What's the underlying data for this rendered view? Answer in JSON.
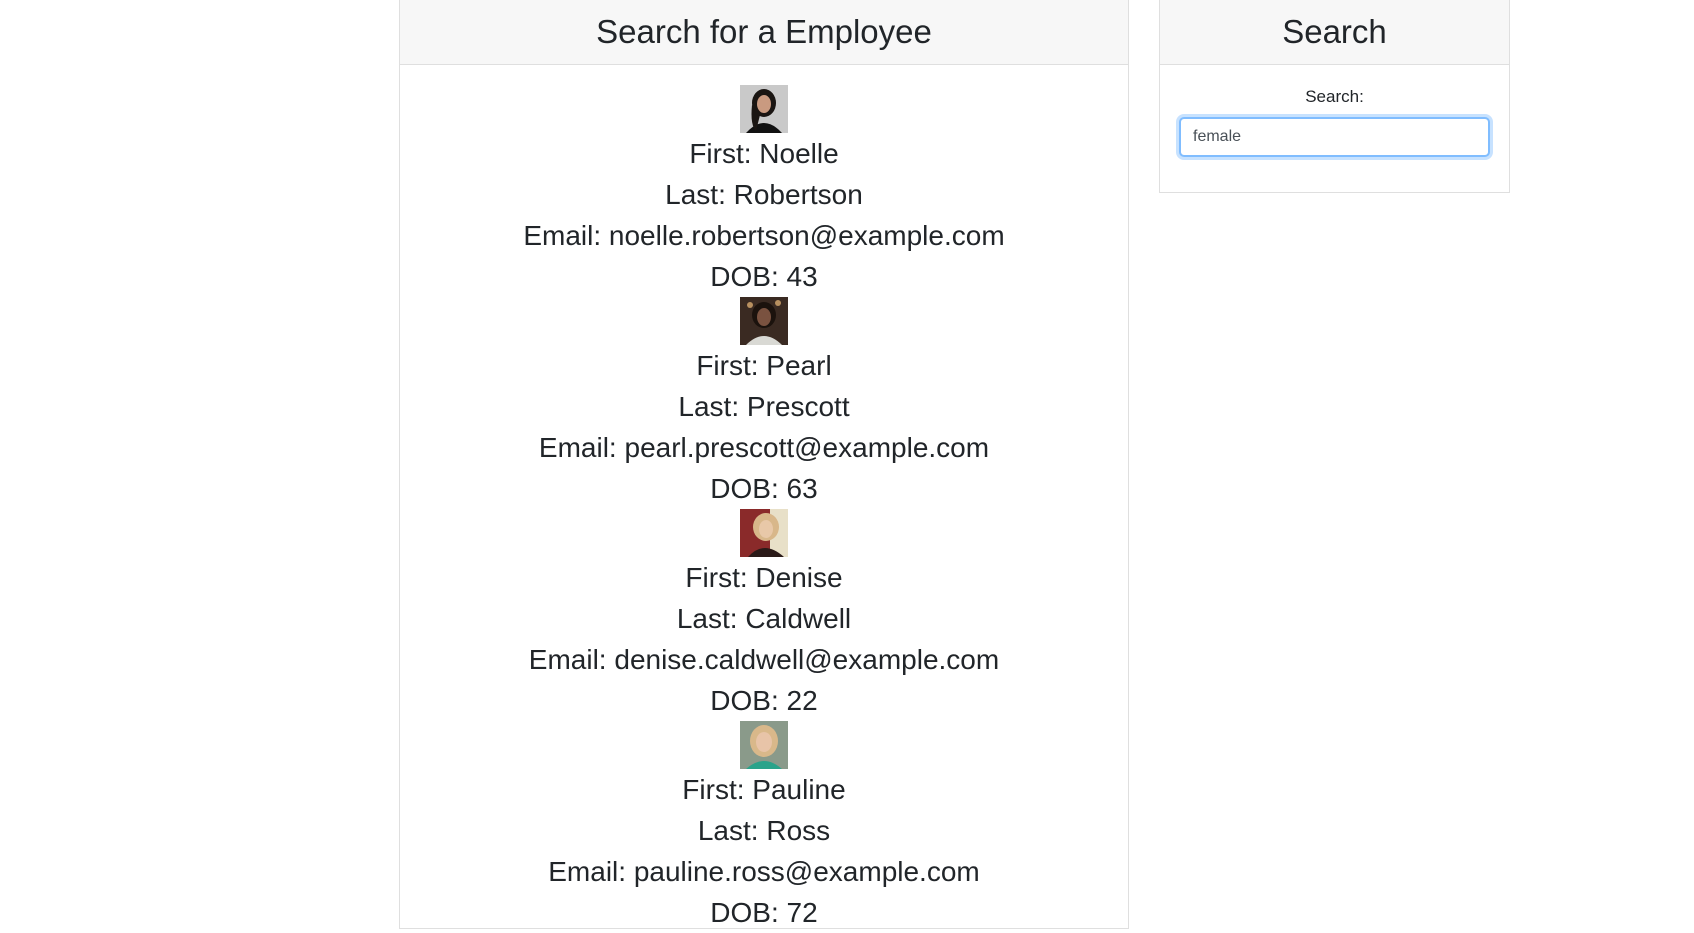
{
  "main": {
    "title": "Search for a Employee",
    "employees": [
      {
        "first": "First: Noelle",
        "last": "Last: Robertson",
        "email": "Email: noelle.robertson@example.com",
        "dob": "DOB: 43",
        "photo_colors": {
          "bg": "#c9c9c9",
          "hair": "#1a1512",
          "skin": "#c99a80",
          "shirt": "#111111"
        }
      },
      {
        "first": "First: Pearl",
        "last": "Last: Prescott",
        "email": "Email: pearl.prescott@example.com",
        "dob": "DOB: 63",
        "photo_colors": {
          "bg": "#3a2a22",
          "hair": "#1b120d",
          "skin": "#7a5240",
          "shirt": "#d9d9d4"
        }
      },
      {
        "first": "First: Denise",
        "last": "Last: Caldwell",
        "email": "Email: denise.caldwell@example.com",
        "dob": "DOB: 22",
        "photo_colors": {
          "bg": "#8a2a2a",
          "hair": "#d8b78a",
          "skin": "#e8c8a8",
          "shirt": "#2a1a18"
        }
      },
      {
        "first": "First: Pauline",
        "last": "Last: Ross",
        "email": "Email: pauline.ross@example.com",
        "dob": "DOB: 72",
        "photo_colors": {
          "bg": "#8a9a8a",
          "hair": "#d9b88a",
          "skin": "#e8c4a8",
          "shirt": "#2aa38a"
        }
      }
    ]
  },
  "sidebar": {
    "title": "Search",
    "label": "Search:",
    "input_value": "female",
    "accent": "#80bdff"
  }
}
